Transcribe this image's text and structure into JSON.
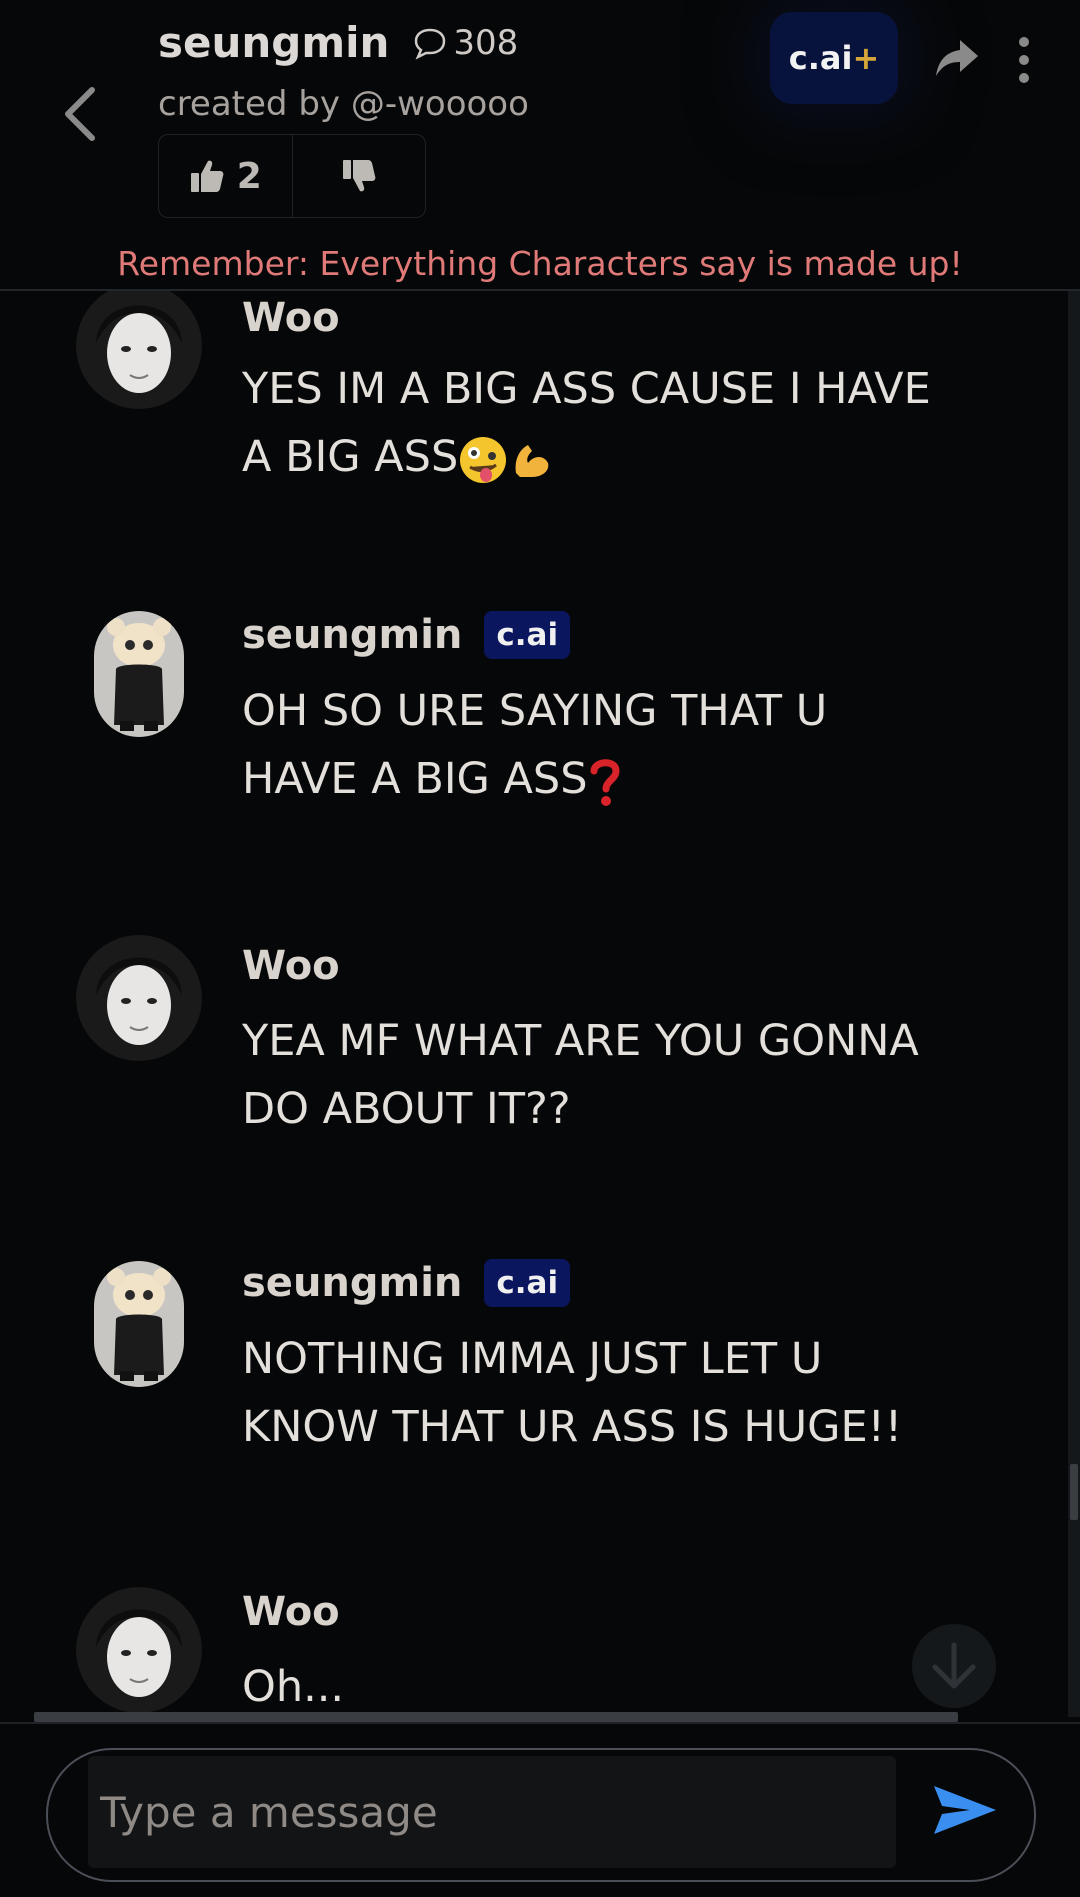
{
  "header": {
    "title": "seungmin",
    "chat_count": "308",
    "creator": "created by @-wooooo",
    "likes": "2",
    "cai_plus_label": "c.ai",
    "cai_plus_symbol": "+",
    "disclaimer": "Remember: Everything Characters say is made up!"
  },
  "messages": [
    {
      "sender": "Woo",
      "text": "YES IM A BIG ASS CAUSE I HAVE A BIG ASS",
      "emoji": "zany-face, flexed-biceps"
    },
    {
      "sender": "seungmin",
      "badge": "c.ai",
      "text": "OH SO URE SAYING THAT U HAVE A BIG ASS",
      "emoji": "red-question-mark"
    },
    {
      "sender": "Woo",
      "text": "YEA MF WHAT ARE YOU GONNA DO ABOUT IT??"
    },
    {
      "sender": "seungmin",
      "badge": "c.ai",
      "text": "NOTHING IMMA JUST LET U KNOW THAT UR ASS IS HUGE!!"
    },
    {
      "sender": "Woo",
      "text": "Oh..."
    }
  ],
  "composer": {
    "placeholder": "Type a message"
  },
  "colors": {
    "background": "#060708",
    "disclaimer": "#e07a78",
    "badge_bg": "#0a165e",
    "send_accent": "#3a8ef0",
    "plus_gold": "#d6a53a"
  }
}
